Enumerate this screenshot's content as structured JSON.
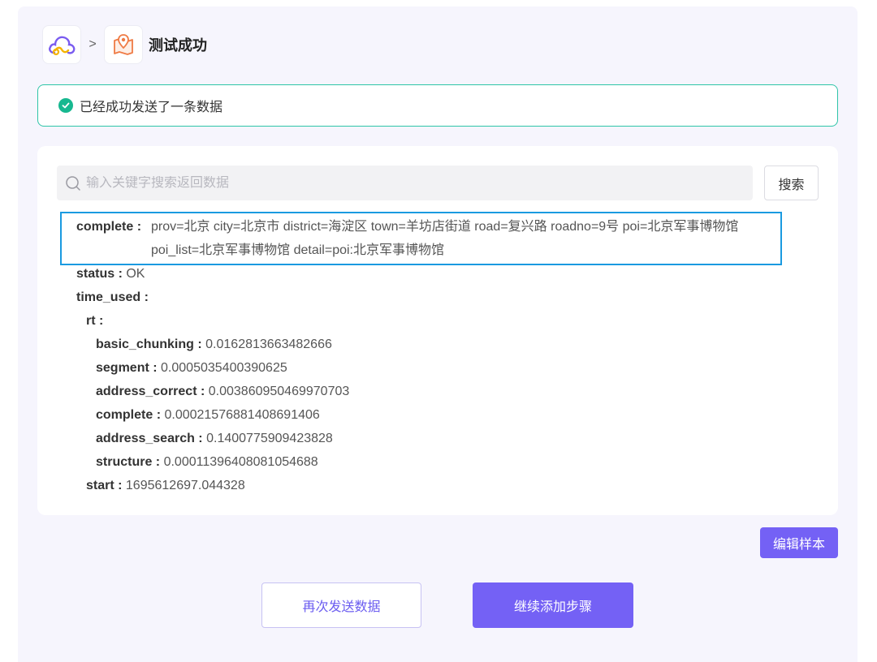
{
  "header": {
    "breadcrumb_separator": ">",
    "step_title": "测试成功"
  },
  "alert": {
    "message": "已经成功发送了一条数据"
  },
  "search": {
    "placeholder": "输入关键字搜索返回数据",
    "button_label": "搜索"
  },
  "result": {
    "complete": {
      "key": "complete :",
      "value": "prov=北京 city=北京市 district=海淀区 town=羊坊店街道 road=复兴路 roadno=9号 poi=北京军事博物馆 poi_list=北京军事博物馆 detail=poi:北京军事博物馆"
    },
    "status": {
      "key": "status :",
      "value": "OK"
    },
    "time_used": {
      "key": "time_used :"
    },
    "rt": {
      "key": "rt :"
    },
    "rt_items": [
      {
        "key": "basic_chunking :",
        "value": "0.0162813663482666"
      },
      {
        "key": "segment :",
        "value": "0.0005035400390625"
      },
      {
        "key": "address_correct :",
        "value": "0.003860950469970703"
      },
      {
        "key": "complete :",
        "value": "0.0002157688140869140​6"
      },
      {
        "key": "address_search :",
        "value": "0.1400775909423828"
      },
      {
        "key": "structure :",
        "value": "0.00011396408081054688"
      }
    ],
    "start": {
      "key": "start :",
      "value": "1695612697.044328"
    }
  },
  "actions": {
    "edit_sample": "编辑样本",
    "resend": "再次发送数据",
    "continue": "继续添加步骤"
  },
  "colors": {
    "accent": "#7461f5",
    "success": "#17b890",
    "highlight_border": "#1a9ae0"
  }
}
